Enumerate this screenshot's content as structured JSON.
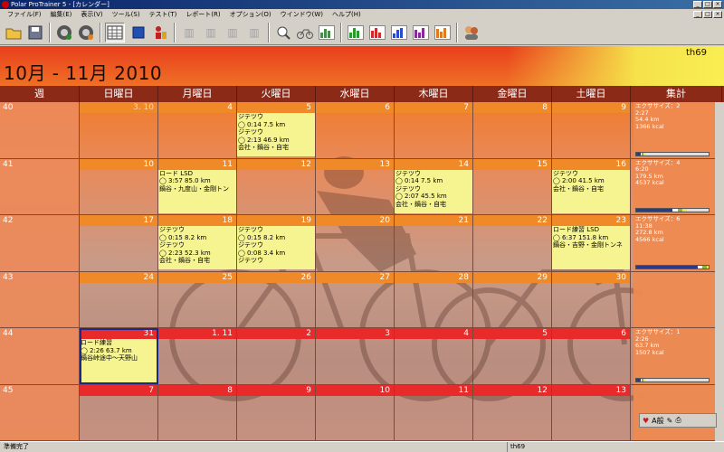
{
  "window": {
    "title": "Polar ProTrainer 5 - [カレンダー]"
  },
  "menu": [
    "ファイル(F)",
    "編集(E)",
    "表示(V)",
    "ツール(S)",
    "テスト(T)",
    "レポート(R)",
    "オプション(O)",
    "ウインドウ(W)",
    "ヘルプ(H)"
  ],
  "toolbar_icons": [
    "open-folder-icon",
    "save-icon",
    "connect-icon",
    "receive-icon",
    "calendar-view-icon",
    "diary-icon",
    "person-test-icon",
    "graph-icon",
    "graph-icon",
    "graph-icon",
    "graph-icon",
    "zoom-icon",
    "bike-icon",
    "graph-icon",
    "report-green-icon",
    "report-red-icon",
    "report-blue-icon",
    "report-purple-icon",
    "report-orange-icon",
    "users-icon"
  ],
  "calendar": {
    "title": "10月 - 11月 2010",
    "user": "th69",
    "headers": [
      "週",
      "日曜日",
      "月曜日",
      "火曜日",
      "水曜日",
      "木曜日",
      "金曜日",
      "土曜日",
      "集計"
    ],
    "weeks": [
      {
        "num": "40",
        "days": [
          "3. 10",
          "4",
          "5",
          "6",
          "7",
          "8",
          "9"
        ],
        "entries": {
          "2": [
            "ジテツウ",
            "◯ 0:14 7.5 km",
            "ジテツウ",
            "◯ 2:13 46.9 km",
            "会社・鍋谷・自宅"
          ]
        },
        "summary": [
          "エクササイズ：2",
          "2:27",
          "54.4 km",
          "1366 kcal"
        ],
        "bar": [
          6,
          2,
          2,
          2
        ]
      },
      {
        "num": "41",
        "days": [
          "10",
          "11",
          "12",
          "13",
          "14",
          "15",
          "16"
        ],
        "entries": {
          "1": [
            "ロード LSD",
            "◯ 3:57 85.0 km",
            "鍋谷・九度山・金剛トン"
          ],
          "4": [
            "ジテツウ",
            "◯ 0:14 7.5 km",
            "ジテツウ",
            "◯ 2:07 45.5 km",
            "会社・鍋谷・自宅"
          ],
          "6": [
            "ジテツウ",
            "◯ 2:00 41.5 km",
            "会社・鍋谷・自宅"
          ]
        },
        "summary": [
          "エクササイズ：4",
          "6:20",
          "179.5 km",
          "4537 kcal"
        ],
        "bar": [
          50,
          8,
          6,
          6
        ]
      },
      {
        "num": "42",
        "days": [
          "17",
          "18",
          "19",
          "20",
          "21",
          "22",
          "23"
        ],
        "entries": {
          "1": [
            "ジテツウ",
            "◯ 0:15 8.2 km",
            "ジテツウ",
            "◯ 2:23 52.3 km",
            "会社・鍋谷・自宅"
          ],
          "2": [
            "ジテツウ",
            "◯ 0:15 8.2 km",
            "ジテツウ",
            "◯ 0:08 3.4 km",
            "ジテツウ"
          ],
          "6": [
            "ロード練習 LSD",
            "◯ 6:37 151.8 km",
            "鍋谷・吉野・金剛トンネ"
          ]
        },
        "summary": [
          "エクササイズ：6",
          "11:38",
          "272.8 km",
          "4566 kcal"
        ],
        "bar": [
          85,
          6,
          6,
          3
        ]
      },
      {
        "num": "43",
        "days": [
          "24",
          "25",
          "26",
          "27",
          "28",
          "29",
          "30"
        ],
        "entries": {},
        "summary": [],
        "bar": []
      },
      {
        "num": "44",
        "days": [
          "31",
          "1. 11",
          "2",
          "3",
          "4",
          "5",
          "6"
        ],
        "entries": {
          "0": [
            "ロード練習",
            "◯ 2:26 63.7 km",
            "鍋谷峠途中～天野山"
          ]
        },
        "summary": [
          "エクササイズ：1",
          "2:26",
          "63.7 km",
          "1507 kcal"
        ],
        "bar": [
          6,
          2,
          2,
          2
        ]
      },
      {
        "num": "45",
        "days": [
          "7",
          "8",
          "9",
          "10",
          "11",
          "12",
          "13"
        ],
        "entries": {},
        "summary": [],
        "bar": []
      }
    ]
  },
  "colors": {
    "entry_bg": "#f6f490",
    "bar_blue": "#2a3a8a",
    "bar_green": "#8ab040",
    "bar_yellow": "#f0e060"
  },
  "status": {
    "left": "準備完了",
    "right": "th69"
  },
  "minitool": {
    "label": "A般"
  }
}
